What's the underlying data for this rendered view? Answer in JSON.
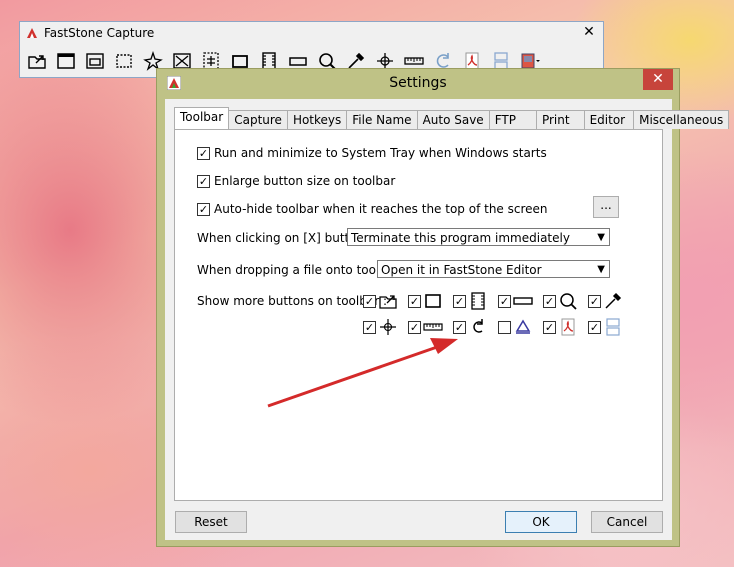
{
  "toolbar_window": {
    "title": "FastStone Capture",
    "close_glyph": "✕",
    "icons": [
      "open-folder-icon",
      "capture-window-icon",
      "capture-object-icon",
      "capture-rectangle-icon",
      "capture-freehand-icon",
      "capture-fullscreen-icon",
      "capture-scrolling-icon",
      "capture-fixed-region-icon",
      "screen-recorder-icon",
      "capture-menu-icon",
      "magnifier-icon",
      "color-picker-icon",
      "crosshair-icon",
      "ruler-icon",
      "repeat-capture-icon",
      "pdf-icon",
      "output-icon",
      "settings-icon"
    ]
  },
  "dialog": {
    "title": "Settings",
    "close_glyph": "✕",
    "tabs": [
      "Toolbar",
      "Capture",
      "Hotkeys",
      "File Name",
      "Auto Save",
      "FTP",
      "Print",
      "Editor",
      "Miscellaneous"
    ],
    "options": {
      "run_minimize": {
        "label": "Run and minimize to System Tray when Windows starts",
        "checked": true
      },
      "enlarge_buttons": {
        "label": "Enlarge button size on toolbar",
        "checked": true
      },
      "auto_hide": {
        "label": "Auto-hide toolbar when it reaches the top of the screen",
        "checked": true
      }
    },
    "ellipsis": "...",
    "close_click": {
      "label": "When clicking on [X] button :",
      "value": "Terminate this program immediately"
    },
    "drop_file": {
      "label": "When dropping a file onto toolbar :",
      "value": "Open it in FastStone Editor"
    },
    "show_more": {
      "label": "Show more buttons on toolbar :"
    },
    "buttons": {
      "reset": "Reset",
      "ok": "OK",
      "cancel": "Cancel"
    },
    "check_glyph": "✓"
  },
  "colors": {
    "dialog_frame": "#bfc286",
    "close_red": "#c7443b",
    "annotation_arrow": "#d42a2a"
  }
}
